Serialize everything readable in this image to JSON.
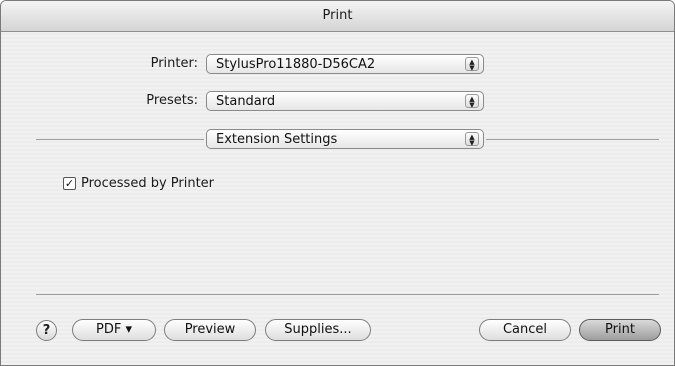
{
  "window": {
    "title": "Print"
  },
  "printer": {
    "label": "Printer:",
    "value": "StylusPro11880-D56CA2"
  },
  "presets": {
    "label": "Presets:",
    "value": "Standard"
  },
  "panel": {
    "value": "Extension Settings"
  },
  "options": {
    "processed_by_printer": {
      "label": "Processed by Printer",
      "checked": true,
      "mark": "✓"
    }
  },
  "buttons": {
    "help": "?",
    "pdf": "PDF ▾",
    "preview": "Preview",
    "supplies": "Supplies...",
    "cancel": "Cancel",
    "print": "Print"
  },
  "icons": {
    "popup_arrows": "▲\n▼"
  }
}
